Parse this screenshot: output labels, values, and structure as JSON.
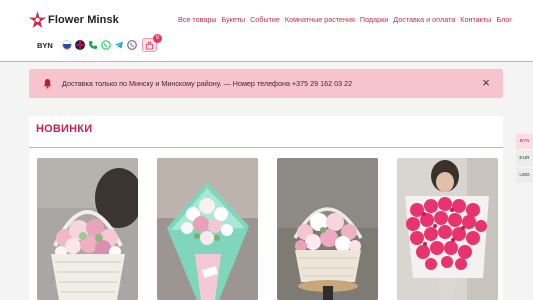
{
  "brand": {
    "name": "Flower Minsk",
    "accent": "#c81f54"
  },
  "nav": {
    "items": [
      "Все товары",
      "Букеты",
      "Событие",
      "Комнатные растения",
      "Подарки",
      "Доставка и оплата",
      "Контакты",
      "Блог"
    ]
  },
  "subbar": {
    "currency": "BYN",
    "icons": [
      "ru-flag-icon",
      "uk-flag-icon",
      "phone-icon",
      "whatsapp-icon",
      "telegram-icon",
      "viber-icon"
    ],
    "cart_count": "0"
  },
  "alert": {
    "text": "Доставка только по Минску и Минскому району. — Номер телефона +375 29 162 03 22",
    "close": "×"
  },
  "section": {
    "title": "НОВИНКИ"
  },
  "products": [
    {
      "name": "basket-mixed-pink-white"
    },
    {
      "name": "bouquet-white-pink-mint"
    },
    {
      "name": "basket-pink-lilies"
    },
    {
      "name": "bouquet-pink-roses"
    }
  ],
  "currency_rail": [
    "BYN",
    "EUR",
    "USD"
  ]
}
